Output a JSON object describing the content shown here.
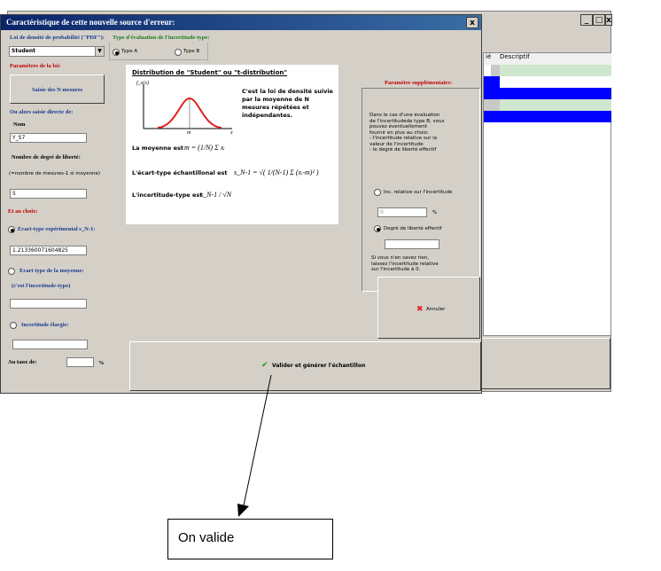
{
  "dialog": {
    "title": "Caractéristique de cette nouvelle source d'erreur:",
    "close_label": "x",
    "pdf_label": "Loi de densité de probabilité (\"PDF\"):",
    "pdf_value": "Student",
    "eval_type_label": "Type d'évaluation de l'incertitude-type:",
    "type_a": "Type A",
    "type_b": "Type B",
    "params_label": "Paramètres de la loi:",
    "enter_measures_button": "Saisie des N mesures",
    "or_direct_label": "Ou alors saisie directe de:",
    "name_label": "Nom",
    "name_value": "Y_S7",
    "dof_label": "Nombre de degré de liberté:",
    "dof_hint": "(=nombre de mesures-1 si moyenne)",
    "dof_value": "5",
    "choice_label": "Et au choix:",
    "sd_exp_label": "Ecart-type expérimental s_N-1:",
    "sd_exp_value": "1.213360071604825",
    "sd_mean_label": "Ecart type de la moyenne:",
    "sd_mean_sub": "(c'est l'incertitude-type)",
    "expanded_label": "Incertitude élargie:",
    "rate_label": "Au taux de:",
    "rate_unit": "%",
    "validate_button": "Valider et générer l'échantillon",
    "cancel_button": "Annuler"
  },
  "info_panel": {
    "heading": "Distribution de \"Student\" ou \"t-distribution\"",
    "plot_ylabel": "f_x(x)",
    "plot_m": "m",
    "plot_x": "x",
    "description": "C'est la loi de densité suivie par la moyenne de N mesures répétées et indépendantes.",
    "mean_label": "La moyenne est",
    "sample_sd_label": "L'écart-type échantillonal est",
    "std_unc_label": "L'incertitude-type est",
    "mean_formula": "m = (1/N) Σ xᵢ",
    "sd_formula": "s_N-1 = √( 1/(N-1) Σ (xᵢ-m)² )",
    "u_formula": "s_N-1 / √N"
  },
  "extra": {
    "heading": "Paramètre supplémentaire:",
    "help_lines": [
      "Dans le cas d'une évaluation",
      "de l'incertitudede type B, vous",
      "pouvez éventuellement",
      "fournir en plus au choix:",
      "- l'incertitude relative sur la",
      "valeur de l'incertitude",
      "- le degré de liberté effectif"
    ],
    "rel_inc_label": "Inc. relative sur l'incertitude",
    "rel_inc_value": "0",
    "rel_inc_unit": "%",
    "dof_eff_label": "Degré de liberté effectif",
    "footer_lines": [
      "Si vous n'en savez rien,",
      "laissez l'incertitude relative",
      "sur l'incertitude à 0."
    ]
  },
  "background_window": {
    "col_headers": [
      "ié",
      "Descriptif"
    ],
    "minimize": "_",
    "maximize": "□",
    "close": "x"
  },
  "callout": {
    "text": "On valide"
  }
}
